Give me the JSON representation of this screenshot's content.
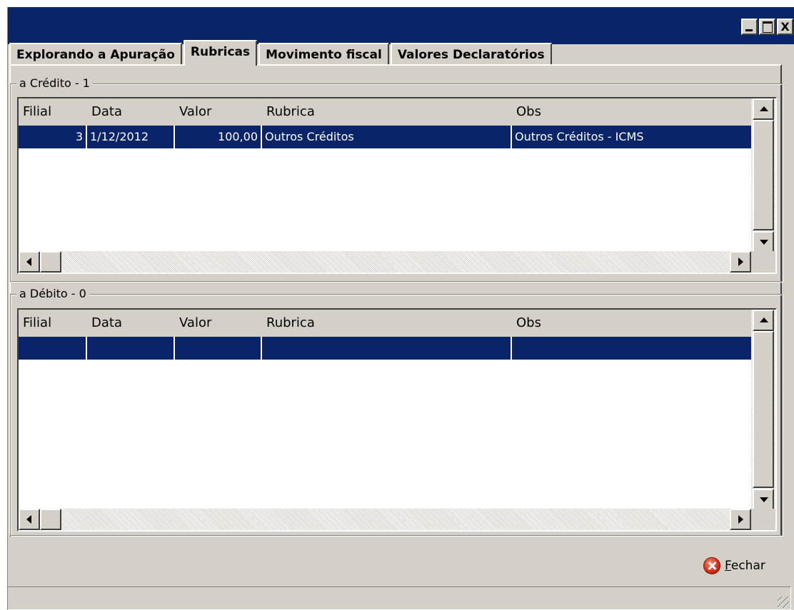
{
  "window": {
    "title": "",
    "controls": {
      "minimize": "_",
      "maximize": "□",
      "close": "X"
    }
  },
  "tabs": [
    {
      "label": "Explorando a Apuração",
      "active": false
    },
    {
      "label": "Rubricas",
      "active": true
    },
    {
      "label": "Movimento fiscal",
      "active": false
    },
    {
      "label": "Valores Declaratórios",
      "active": false
    }
  ],
  "columns": [
    "Filial",
    "Data",
    "Valor",
    "Rubrica",
    "Obs"
  ],
  "credito": {
    "legend": "a Crédito - 1",
    "rows": [
      {
        "filial": "3",
        "data": "1/12/2012",
        "valor": "100,00",
        "rubrica": "Outros Créditos",
        "obs": "Outros Créditos - ICMS"
      }
    ]
  },
  "debito": {
    "legend": "a Débito - 0",
    "rows": [
      {
        "filial": "",
        "data": "",
        "valor": "",
        "rubrica": "",
        "obs": ""
      }
    ]
  },
  "footer": {
    "fechar_accel": "F",
    "fechar_rest": "echar",
    "icon": "close-circle-icon"
  },
  "colors": {
    "titlebar": "#0a246a",
    "selection": "#0a246a",
    "face": "#d4d0c8"
  }
}
